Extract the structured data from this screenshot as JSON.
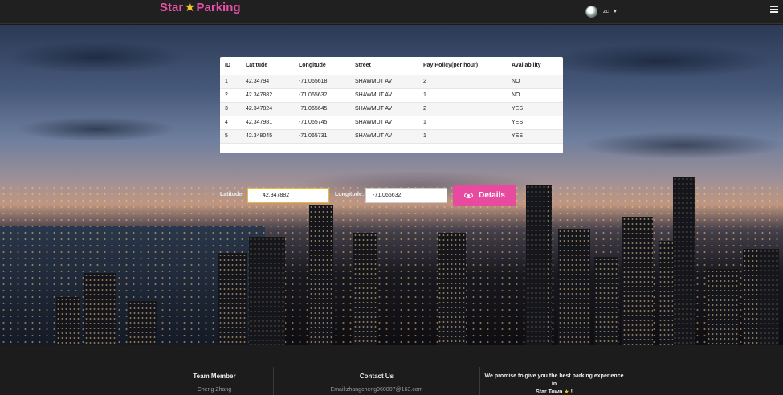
{
  "navbar": {
    "brand_left": "Star",
    "brand_right": "Parking",
    "user_name": "zc"
  },
  "table": {
    "headers": [
      "ID",
      "Latitude",
      "Longitude",
      "Street",
      "Pay Policy(per hour)",
      "Availability"
    ],
    "rows": [
      [
        "1",
        "42.34794",
        "-71.065618",
        "SHAWMUT AV",
        "2",
        "NO"
      ],
      [
        "2",
        "42.347882",
        "-71.065632",
        "SHAWMUT AV",
        "1",
        "NO"
      ],
      [
        "3",
        "42.347824",
        "-71.065645",
        "SHAWMUT AV",
        "2",
        "YES"
      ],
      [
        "4",
        "42.347981",
        "-71.065745",
        "SHAWMUT AV",
        "1",
        "YES"
      ],
      [
        "5",
        "42.348045",
        "-71.065731",
        "SHAWMUT AV",
        "1",
        "YES"
      ]
    ]
  },
  "form": {
    "latitude_label": "Latitude:",
    "latitude_value": "42.347882",
    "longitude_label": "Longitude:",
    "longitude_value": "-71.065632",
    "details_label": "Details"
  },
  "footer": {
    "team_title": "Team Member",
    "team_name": "Cheng Zhang",
    "contact_title": "Contact Us",
    "contact_email": "Email:zhangcheng960807@163.com",
    "promise_line1": "We promise to give you the best parking experience in",
    "promise_line2_prefix": "Star Town",
    "promise_line2_suffix": "!"
  },
  "colors": {
    "brand": "#e84fa8",
    "accent_button": "#e84a9f",
    "star": "#f4c430"
  },
  "icons": [
    "star-icon",
    "avatar",
    "caret-down-icon",
    "hamburger-menu-icon",
    "eye-icon"
  ]
}
